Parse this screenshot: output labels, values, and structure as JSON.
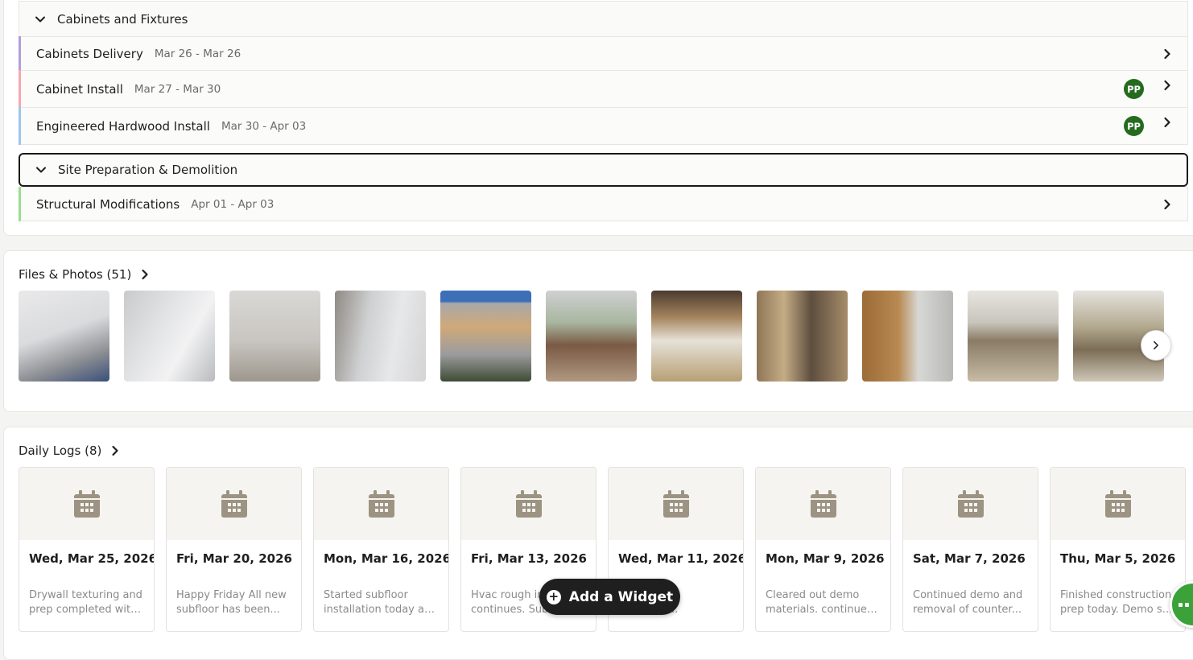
{
  "schedule": {
    "groups": [
      {
        "label": "Cabinets and Fixtures"
      },
      {
        "label": "Site Preparation & Demolition"
      }
    ],
    "tasks": [
      {
        "name": "Cabinets Delivery",
        "dates": "Mar 26 - Mar 26",
        "color": "#b39ddb",
        "assignee": ""
      },
      {
        "name": "Cabinet Install",
        "dates": "Mar 27 - Mar 30",
        "color": "#f4a7b0",
        "assignee": "PP"
      },
      {
        "name": "Engineered Hardwood Install",
        "dates": "Mar 30 - Apr 03",
        "color": "#9ec5f0",
        "assignee": "PP"
      },
      {
        "name": "Structural Modifications",
        "dates": "Apr 01 - Apr 03",
        "color": "#9adf8f",
        "assignee": ""
      }
    ]
  },
  "files": {
    "title": "Files & Photos (51)"
  },
  "logs": {
    "title": "Daily Logs (8)",
    "items": [
      {
        "date": "Wed, Mar 25, 2026",
        "line1": "Drywall texturing and",
        "line2": "prep completed with..."
      },
      {
        "date": "Fri, Mar 20, 2026",
        "line1": "Happy Friday All new",
        "line2": "subfloor has been..."
      },
      {
        "date": "Mon, Mar 16, 2026",
        "line1": "Started subfloor",
        "line2": "installation today as..."
      },
      {
        "date": "Fri, Mar 13, 2026",
        "line1": "Hvac rough in",
        "line2": "continues. Subf"
      },
      {
        "date": "Wed, Mar 11, 2026",
        "line1": "or",
        "line2": "w subfloo..."
      },
      {
        "date": "Mon, Mar 9, 2026",
        "line1": "Cleared out demo",
        "line2": "materials. continued..."
      },
      {
        "date": "Sat, Mar 7, 2026",
        "line1": "Continued demo and",
        "line2": "removal of counter..."
      },
      {
        "date": "Thu, Mar 5, 2026",
        "line1": "Finished construction",
        "line2": "prep today. Demo still..."
      }
    ]
  },
  "add_widget": {
    "label": "Add a Widget"
  },
  "icons": {
    "group_toggle": "chevron-down-icon",
    "row_open": "chevron-right-icon",
    "log_thumb": "calendar-icon",
    "carousel_next": "chevron-right-icon",
    "add": "plus-circle-icon",
    "chat": "chat-icon"
  },
  "colors": {
    "avatar": "#256b1e",
    "chat": "#3aa238",
    "widget_button": "#1f1f1f"
  }
}
